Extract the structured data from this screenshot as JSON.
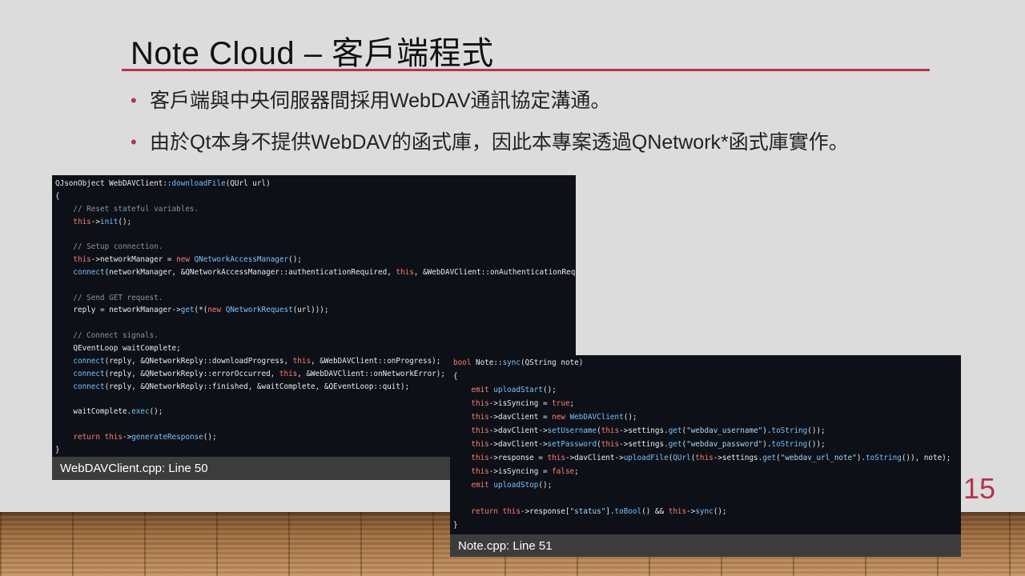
{
  "slide": {
    "title": "Note Cloud  –  客戶端程式",
    "bullets": [
      "客戶端與中央伺服器間採用WebDAV通訊協定溝通。",
      "由於Qt本身不提供WebDAV的函式庫，因此本專案透過QNetwork*函式庫實作。"
    ],
    "bullet_glyph": "•",
    "page_number": "15"
  },
  "code_blocks": [
    {
      "caption": "WebDAVClient.cpp: Line 50",
      "lines": [
        "QJsonObject WebDAVClient::downloadFile(QUrl url)",
        "{",
        "    // Reset stateful variables.",
        "    this->init();",
        "",
        "    // Setup connection.",
        "    this->networkManager = new QNetworkAccessManager();",
        "    connect(networkManager, &QNetworkAccessManager::authenticationRequired, this, &WebDAVClient::onAuthenticationRequired);",
        "",
        "    // Send GET request.",
        "    reply = networkManager->get(*(new QNetworkRequest(url)));",
        "",
        "    // Connect signals.",
        "    QEventLoop waitComplete;",
        "    connect(reply, &QNetworkReply::downloadProgress, this, &WebDAVClient::onProgress);",
        "    connect(reply, &QNetworkReply::errorOccurred, this, &WebDAVClient::onNetworkError);",
        "    connect(reply, &QNetworkReply::finished, &waitComplete, &QEventLoop::quit);",
        "",
        "    waitComplete.exec();",
        "",
        "    return this->generateResponse();",
        "}"
      ]
    },
    {
      "caption": "Note.cpp: Line 51",
      "lines": [
        "bool Note::sync(QString note)",
        "{",
        "    emit uploadStart();",
        "    this->isSyncing = true;",
        "    this->davClient = new WebDAVClient();",
        "    this->davClient->setUsername(this->settings.get(\"webdav_username\").toString());",
        "    this->davClient->setPassword(this->settings.get(\"webdav_password\").toString());",
        "    this->response = this->davClient->uploadFile(QUrl(this->settings.get(\"webdav_url_note\").toString()), note);",
        "    this->isSyncing = false;",
        "    emit uploadStop();",
        "",
        "    return this->response[\"status\"].toBool() && this->sync();",
        "}"
      ]
    }
  ],
  "colors": {
    "accent": "#b5344a",
    "code_background": "#0d1117",
    "caption_background": "#3c3c3c"
  }
}
